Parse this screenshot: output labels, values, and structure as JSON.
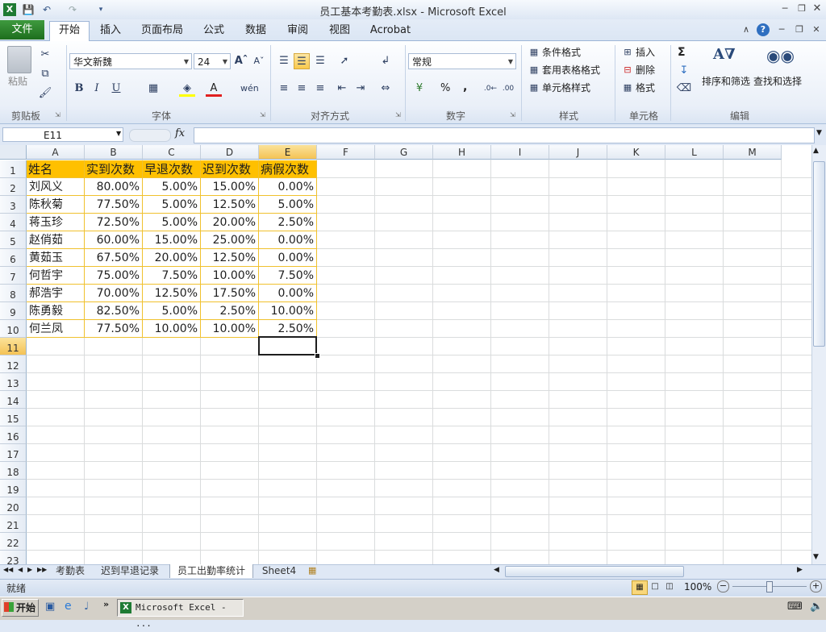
{
  "window": {
    "title": "员工基本考勤表.xlsx - Microsoft Excel"
  },
  "ribbon_tabs": [
    "开始",
    "插入",
    "页面布局",
    "公式",
    "数据",
    "审阅",
    "视图",
    "Acrobat"
  ],
  "file_tab": "文件",
  "clipboard": {
    "paste": "粘贴",
    "group": "剪贴板"
  },
  "font": {
    "name": "华文新魏",
    "size": "24",
    "group": "字体"
  },
  "alignment": {
    "group": "对齐方式"
  },
  "number": {
    "format": "常规",
    "group": "数字",
    "percent": "%",
    "comma": ","
  },
  "styles": {
    "cond": "条件格式",
    "table": "套用表格格式",
    "cell": "单元格样式",
    "group": "样式"
  },
  "cells": {
    "insert": "插入",
    "delete": "删除",
    "format": "格式",
    "group": "单元格"
  },
  "editing": {
    "sort": "排序和筛选",
    "find": "查找和选择",
    "group": "编辑",
    "sigma": "Σ"
  },
  "formula_bar": {
    "namebox": "E11",
    "fx": "fx",
    "value": ""
  },
  "columns": [
    "A",
    "B",
    "C",
    "D",
    "E",
    "F",
    "G",
    "H",
    "I",
    "J",
    "K",
    "L",
    "M"
  ],
  "rows": [
    "1",
    "2",
    "3",
    "4",
    "5",
    "6",
    "7",
    "8",
    "9",
    "10",
    "11",
    "12",
    "13",
    "14",
    "15",
    "16",
    "17",
    "18",
    "19",
    "20",
    "21",
    "22",
    "23"
  ],
  "table": {
    "headers": [
      "姓名",
      "实到次数",
      "早退次数",
      "迟到次数",
      "病假次数"
    ],
    "rows": [
      [
        "刘风义",
        "80.00%",
        "5.00%",
        "15.00%",
        "0.00%"
      ],
      [
        "陈秋菊",
        "77.50%",
        "5.00%",
        "12.50%",
        "5.00%"
      ],
      [
        "蒋玉珍",
        "72.50%",
        "5.00%",
        "20.00%",
        "2.50%"
      ],
      [
        "赵俏茹",
        "60.00%",
        "15.00%",
        "25.00%",
        "0.00%"
      ],
      [
        "黄茹玉",
        "67.50%",
        "20.00%",
        "12.50%",
        "0.00%"
      ],
      [
        "何哲宇",
        "75.00%",
        "7.50%",
        "10.00%",
        "7.50%"
      ],
      [
        "郝浩宇",
        "70.00%",
        "12.50%",
        "17.50%",
        "0.00%"
      ],
      [
        "陈勇毅",
        "82.50%",
        "5.00%",
        "2.50%",
        "10.00%"
      ],
      [
        "何兰凤",
        "77.50%",
        "10.00%",
        "10.00%",
        "2.50%"
      ]
    ]
  },
  "sheet_tabs": [
    "考勤表",
    "迟到早退记录",
    "员工出勤率统计",
    "Sheet4"
  ],
  "active_sheet": "员工出勤率统计",
  "status": {
    "ready": "就绪",
    "zoom": "100%"
  },
  "taskbar": {
    "start": "开始",
    "excel": "Microsoft Excel - ..."
  }
}
